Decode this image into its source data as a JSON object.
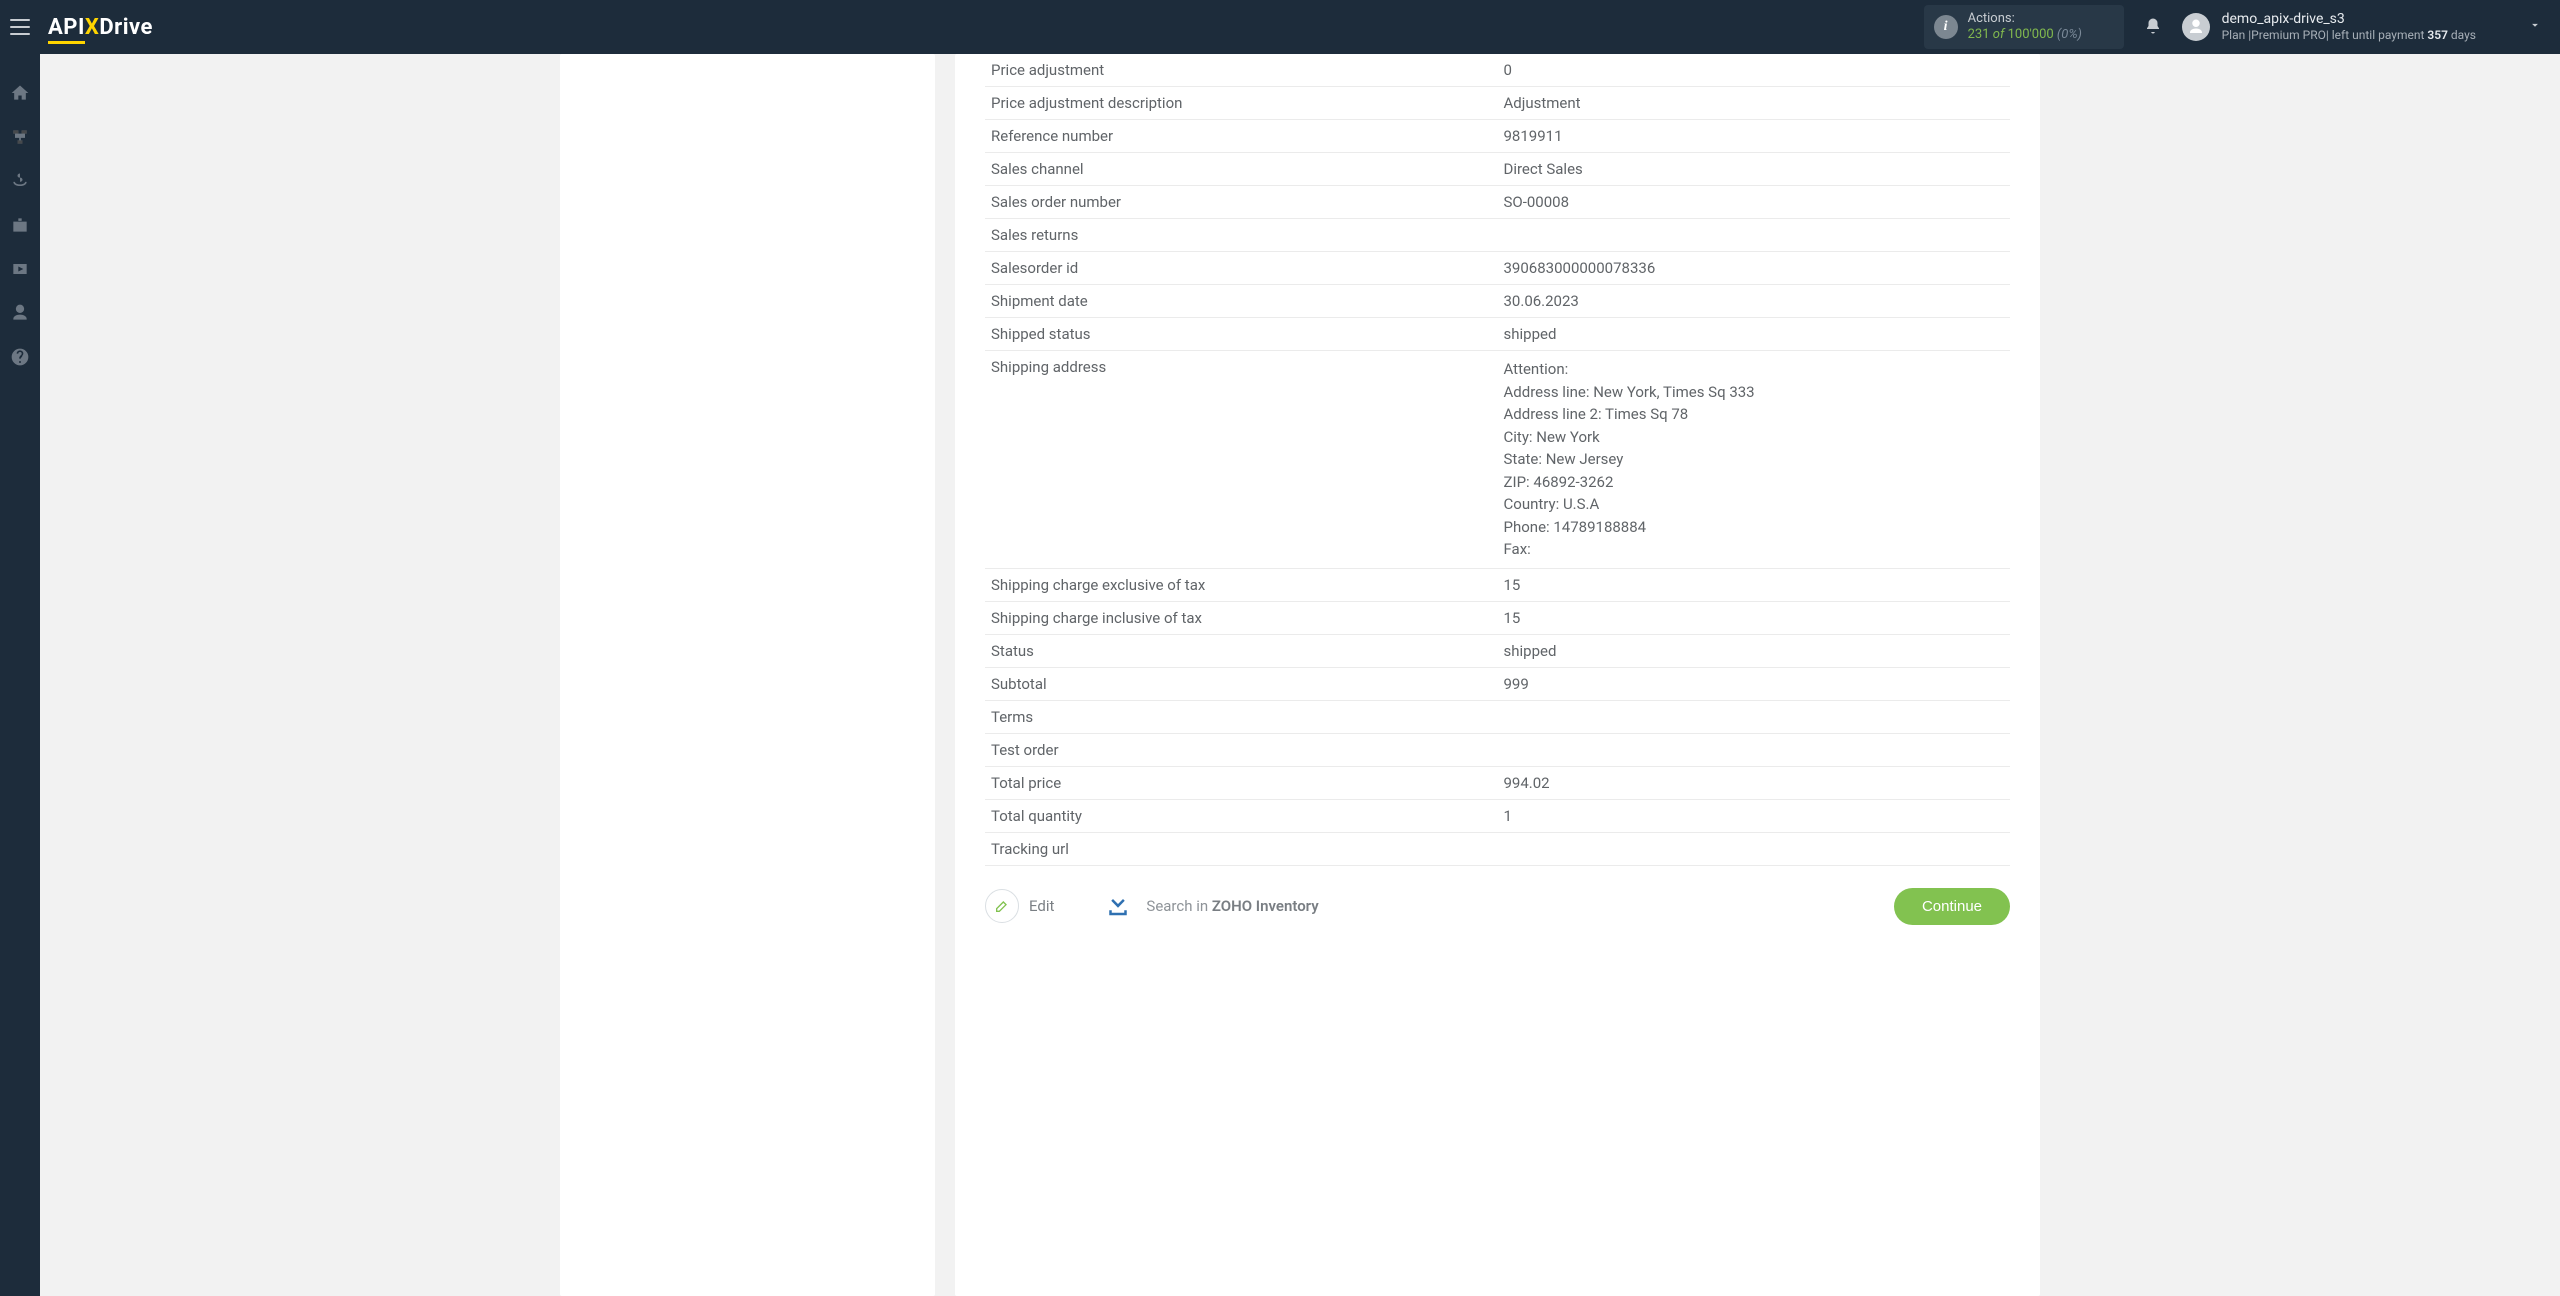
{
  "logo": {
    "part1": "API",
    "part2": "X",
    "part3": "Drive"
  },
  "topbar": {
    "actions_label": "Actions:",
    "actions_used": "231",
    "actions_of": "of",
    "actions_total": "100'000",
    "actions_pct": "(0%)"
  },
  "user": {
    "username": "demo_apix-drive_s3",
    "plan_prefix": "Plan |",
    "plan_name": "Premium PRO",
    "plan_mid": "| left until payment ",
    "plan_days": "357",
    "plan_suffix": " days"
  },
  "rows": [
    {
      "label": "Price adjustment",
      "value": "0"
    },
    {
      "label": "Price adjustment description",
      "value": "Adjustment"
    },
    {
      "label": "Reference number",
      "value": "9819911"
    },
    {
      "label": "Sales channel",
      "value": "Direct Sales"
    },
    {
      "label": "Sales order number",
      "value": "SO-00008"
    },
    {
      "label": "Sales returns",
      "value": ""
    },
    {
      "label": "Salesorder id",
      "value": "390683000000078336"
    },
    {
      "label": "Shipment date",
      "value": "30.06.2023"
    },
    {
      "label": "Shipped status",
      "value": "shipped"
    },
    {
      "label": "Shipping address",
      "address": [
        "Attention:",
        "Address line: New York, Times Sq 333",
        "Address line 2: Times Sq 78",
        "City: New York",
        "State: New Jersey",
        "ZIP: 46892-3262",
        "Country: U.S.A",
        "Phone: 14789188884",
        "Fax:"
      ]
    },
    {
      "label": "Shipping charge exclusive of tax",
      "value": "15"
    },
    {
      "label": "Shipping charge inclusive of tax",
      "value": "15"
    },
    {
      "label": "Status",
      "value": "shipped"
    },
    {
      "label": "Subtotal",
      "value": "999"
    },
    {
      "label": "Terms",
      "value": ""
    },
    {
      "label": "Test order",
      "value": ""
    },
    {
      "label": "Total price",
      "value": "994.02"
    },
    {
      "label": "Total quantity",
      "value": "1"
    },
    {
      "label": "Tracking url",
      "value": ""
    }
  ],
  "footer": {
    "edit": "Edit",
    "search_prefix": "Search in ",
    "search_target": "ZOHO Inventory",
    "continue": "Continue"
  }
}
